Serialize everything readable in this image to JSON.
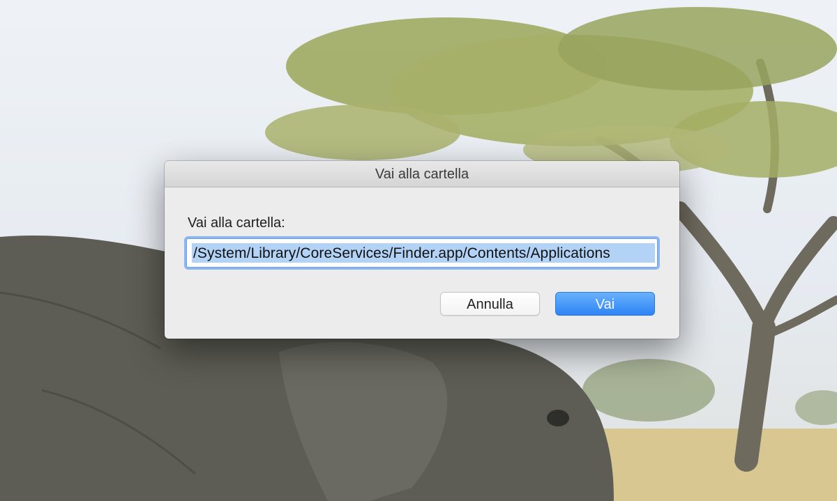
{
  "dialog": {
    "title": "Vai alla cartella",
    "prompt_label": "Vai alla cartella:",
    "path_value": "/System/Library/CoreServices/Finder.app/Contents/Applications",
    "cancel_label": "Annulla",
    "go_label": "Vai"
  },
  "colors": {
    "accent_button": "#2d84f6",
    "field_focus_ring": "#8ab6f2",
    "text_selection": "#b3d3f6"
  },
  "wallpaper": {
    "subject": "elephant-under-acacia-tree"
  }
}
